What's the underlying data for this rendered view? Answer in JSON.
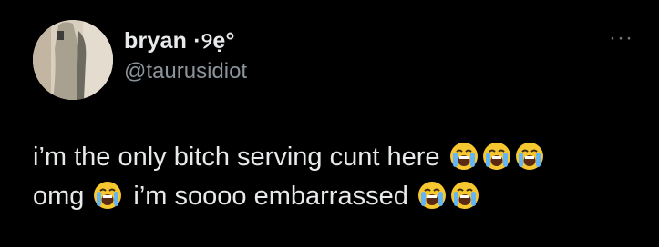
{
  "tweet": {
    "display_name": "bryan ·୨ẹ°",
    "handle": "@taurusidiot",
    "more_label": "···",
    "text_line1_a": "i’m the only bitch serving cunt here",
    "text_line2_a": "omg",
    "text_line2_b": "i’m soooo embarrassed"
  },
  "icons": {
    "emoji": "loudly-crying-face-icon",
    "more": "more-options-icon"
  },
  "colors": {
    "background": "#000000",
    "text": "#e7e9ea",
    "secondary_text": "#8b949b",
    "emoji_face": "#f7c72f",
    "tears": "#64b5f6"
  }
}
